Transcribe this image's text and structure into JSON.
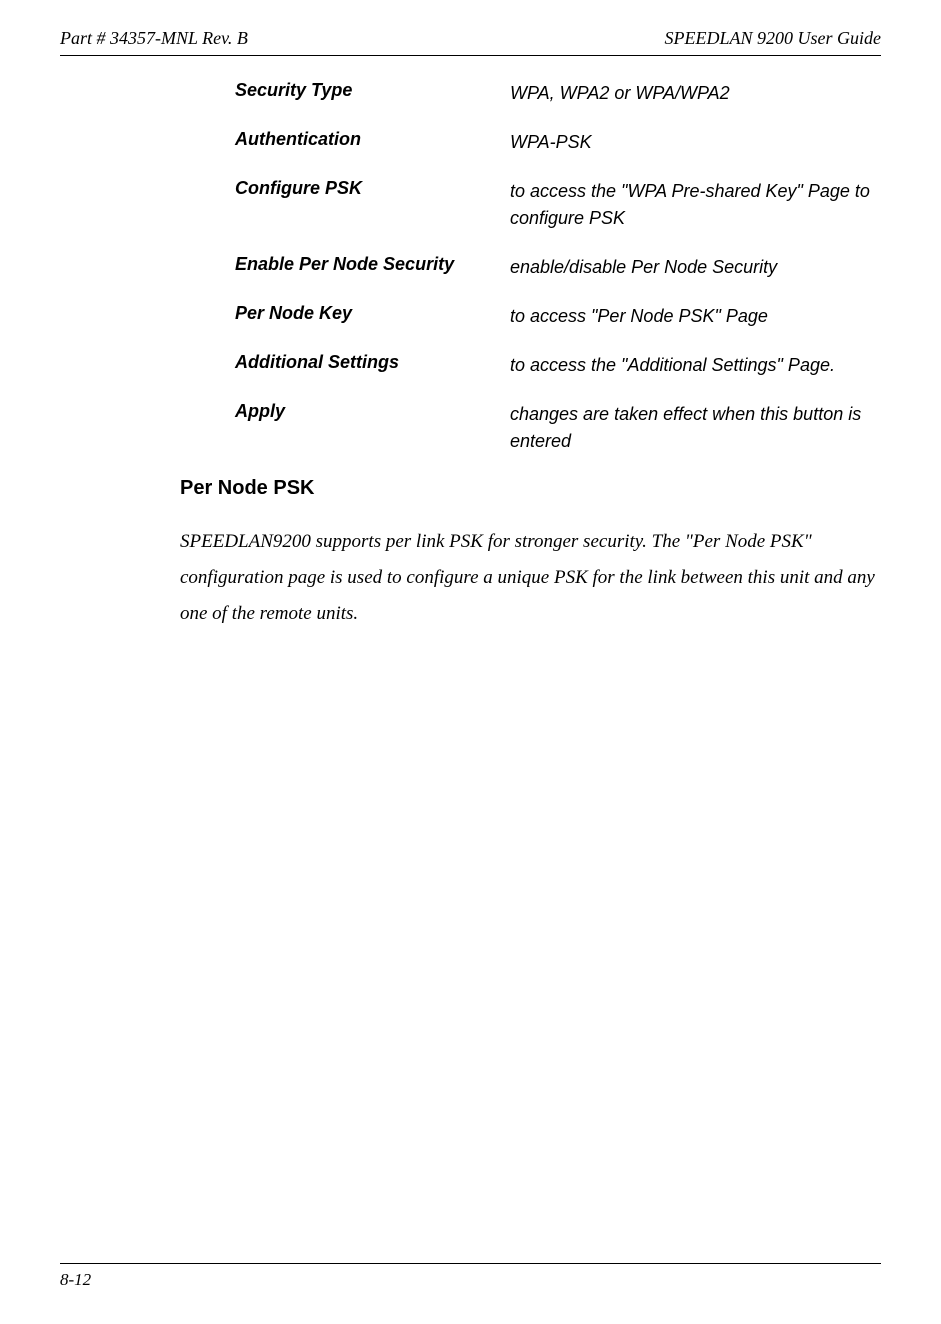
{
  "header": {
    "left": "Part # 34357-MNL Rev. B",
    "right": "SPEEDLAN 9200 User Guide"
  },
  "definitions": [
    {
      "term": "Security Type",
      "desc": "WPA, WPA2 or WPA/WPA2"
    },
    {
      "term": "Authentication",
      "desc": "WPA-PSK"
    },
    {
      "term": "Configure PSK",
      "desc": "to access the \"WPA Pre-shared Key\" Page to configure PSK"
    },
    {
      "term": "Enable Per Node Security",
      "desc": "enable/disable Per Node Security"
    },
    {
      "term": "Per Node Key",
      "desc": "to access \"Per Node PSK\" Page"
    },
    {
      "term": "Additional Settings",
      "desc": "to access the \"Additional Settings\" Page."
    },
    {
      "term": "Apply",
      "desc": "changes are taken effect when this button is entered"
    }
  ],
  "section": {
    "heading": "Per Node PSK",
    "paragraph": " SPEEDLAN9200 supports per link PSK for stronger security. The \"Per Node PSK\" configuration page is used to configure a unique PSK for the link between this unit and any one of the remote units."
  },
  "footer": {
    "page": "8-12"
  }
}
